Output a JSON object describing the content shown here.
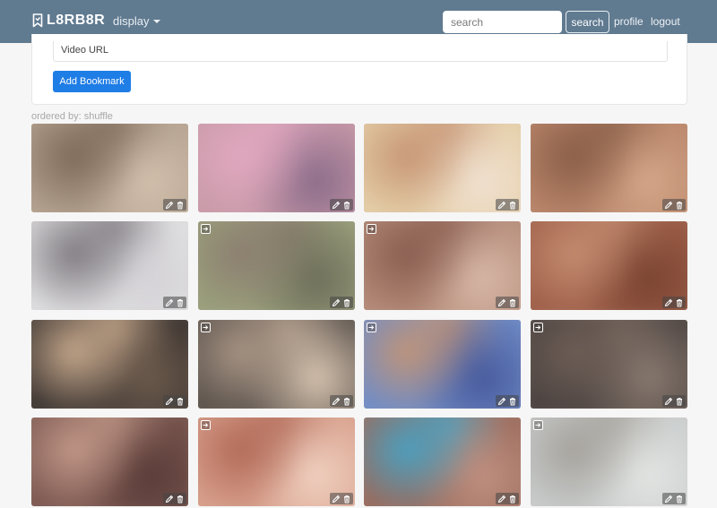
{
  "navbar": {
    "brand": "L8RB8R",
    "display_label": "display",
    "search_placeholder": "search",
    "search_button": "search",
    "profile_link": "profile",
    "logout_link": "logout",
    "bg_color": "#607a90"
  },
  "form": {
    "video_url_placeholder": "Video URL",
    "add_button": "Add Bookmark",
    "accent_color": "#1f7de6"
  },
  "sort": {
    "ordered_label": "ordered by: shuffle"
  },
  "bookmarks": [
    {
      "has_enter_icon": false,
      "colors": [
        "#b4a290",
        "#7d6a59",
        "#d2c0ad"
      ]
    },
    {
      "has_enter_icon": false,
      "colors": [
        "#c89aa8",
        "#e2a8c0",
        "#8c6c8a"
      ]
    },
    {
      "has_enter_icon": false,
      "colors": [
        "#e5cfa8",
        "#c79676",
        "#f0e0d0"
      ]
    },
    {
      "has_enter_icon": false,
      "colors": [
        "#b9856a",
        "#8a5e48",
        "#d4a688"
      ]
    },
    {
      "has_enter_icon": false,
      "colors": [
        "#e0e0e2",
        "#7f7a80",
        "#d4d2d6"
      ]
    },
    {
      "has_enter_icon": true,
      "colors": [
        "#9aa07c",
        "#8c7e70",
        "#6e6e5a"
      ]
    },
    {
      "has_enter_icon": true,
      "colors": [
        "#b48a78",
        "#8a5e50",
        "#d8b8a8"
      ]
    },
    {
      "has_enter_icon": false,
      "colors": [
        "#9e5e48",
        "#c48c70",
        "#7a4432"
      ]
    },
    {
      "has_enter_icon": false,
      "colors": [
        "#3a3330",
        "#c6a88c",
        "#6c5a4c"
      ]
    },
    {
      "has_enter_icon": true,
      "colors": [
        "#5a524c",
        "#a89484",
        "#d8c4b0"
      ]
    },
    {
      "has_enter_icon": true,
      "colors": [
        "#6e8cc8",
        "#c09478",
        "#485a9c"
      ]
    },
    {
      "has_enter_icon": true,
      "colors": [
        "#4a4240",
        "#6e5e56",
        "#8a7a70"
      ]
    },
    {
      "has_enter_icon": false,
      "colors": [
        "#7a5650",
        "#c29888",
        "#5a3c38"
      ]
    },
    {
      "has_enter_icon": true,
      "colors": [
        "#d8a08c",
        "#b26a58",
        "#f0d0c0"
      ]
    },
    {
      "has_enter_icon": false,
      "colors": [
        "#9a6a5c",
        "#4aa0c0",
        "#c09080"
      ]
    },
    {
      "has_enter_icon": true,
      "colors": [
        "#c8cccc",
        "#a6a29c",
        "#e2e4e2"
      ]
    }
  ]
}
